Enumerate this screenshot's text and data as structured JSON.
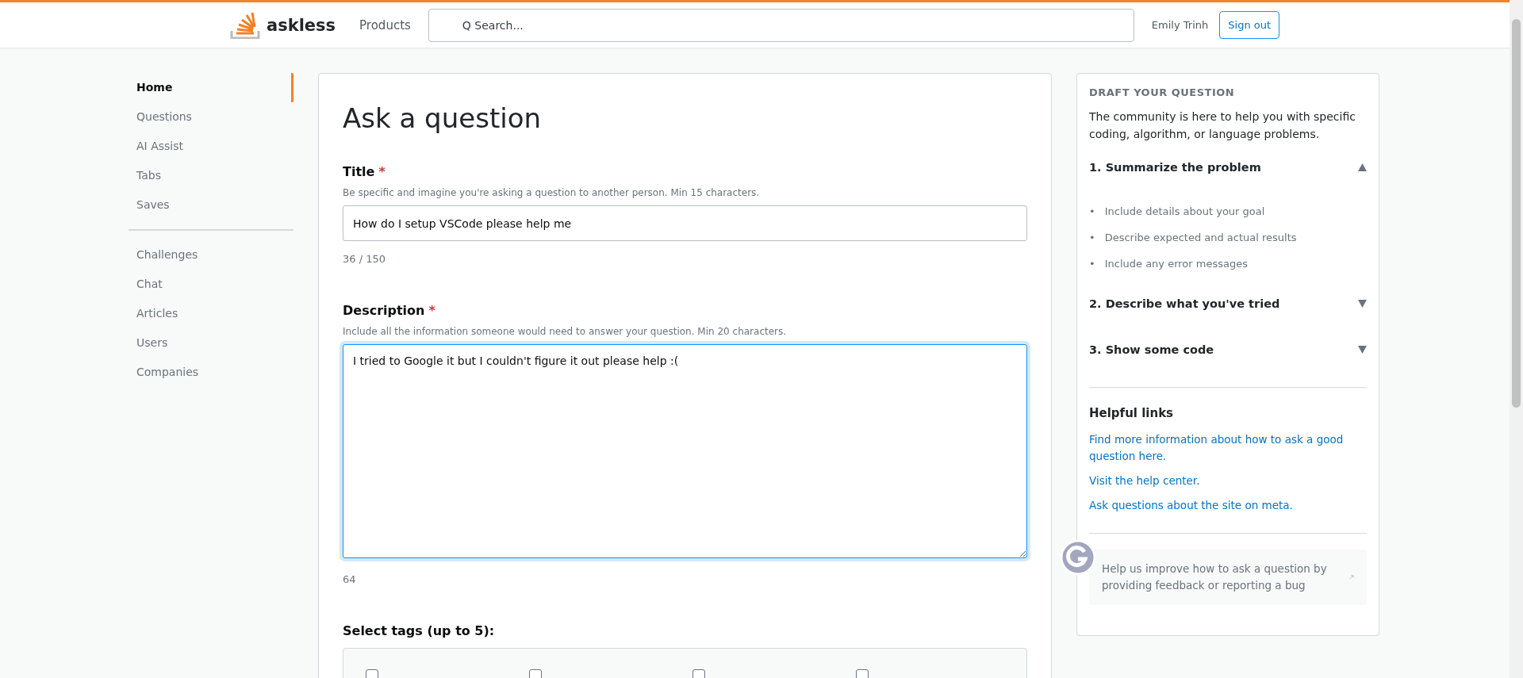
{
  "header": {
    "logo": "askless",
    "nav": "Products",
    "search": {
      "placeholder": "Q Search..."
    },
    "user": "Emily Trinh",
    "signout": "Sign out"
  },
  "sidebar": {
    "groups": [
      [
        {
          "label": "Home",
          "selected": true
        },
        {
          "label": "Questions",
          "selected": false
        },
        {
          "label": "AI Assist",
          "selected": false
        },
        {
          "label": "Tabs",
          "selected": false
        },
        {
          "label": "Saves",
          "selected": false
        }
      ],
      [
        {
          "label": "Challenges",
          "selected": false
        },
        {
          "label": "Chat",
          "selected": false
        },
        {
          "label": "Articles",
          "selected": false
        },
        {
          "label": "Users",
          "selected": false
        },
        {
          "label": "Companies",
          "selected": false
        }
      ]
    ]
  },
  "form": {
    "heading": "Ask a question",
    "fields": [
      {
        "kind": "input",
        "label": "Title",
        "required": "*",
        "hint": "Be specific and imagine you're asking a question to another person. Min 15 characters.",
        "value": "How do I setup VSCode please help me",
        "counter": "36 / 150",
        "focused": false
      },
      {
        "kind": "textarea",
        "label": "Description",
        "required": "*",
        "hint": "Include all the information someone would need to answer your question. Min 20 characters.",
        "value": "I tried to Google it but I couldn't figure it out please help :(",
        "counter": "64",
        "focused": true
      }
    ],
    "tags": {
      "label": "Select tags (up to 5):",
      "options": [
        {
          "checked": false
        },
        {
          "checked": false
        },
        {
          "checked": false
        },
        {
          "checked": false
        }
      ]
    }
  },
  "draft": {
    "title": "DRAFT YOUR QUESTION",
    "intro": "The community is here to help you with specific coding, algorithm, or language problems.",
    "steps": [
      {
        "title": "1. Summarize the problem",
        "expanded": true,
        "bullets": [
          {
            "marker": "•",
            "text": "Include details about your goal"
          },
          {
            "marker": "•",
            "text": "Describe expected and actual results"
          },
          {
            "marker": "•",
            "text": "Include any error messages"
          }
        ]
      },
      {
        "title": "2. Describe what you've tried",
        "expanded": false
      },
      {
        "title": "3. Show some code",
        "expanded": false
      }
    ],
    "links_title": "Helpful links",
    "links": [
      "Find more information about how to ask a good question here.",
      "Visit the help center.",
      "Ask questions about the site on meta."
    ],
    "feedback": "Help us improve how to ask a question by providing feedback or reporting a bug"
  }
}
